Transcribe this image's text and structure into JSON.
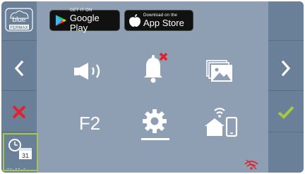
{
  "brand": {
    "logo_text": "blue",
    "logo_subtext": "FERMAX"
  },
  "store_buttons": {
    "google": {
      "small": "GET IT ON",
      "big": "Google Play"
    },
    "apple": {
      "small": "Download on the",
      "big": "App Store"
    }
  },
  "menu": {
    "f2_label": "F2",
    "items": [
      {
        "icon": "volume-icon"
      },
      {
        "icon": "bell-muted-icon"
      },
      {
        "icon": "gallery-icon"
      },
      {
        "icon": "f2-label"
      },
      {
        "icon": "gear-icon",
        "selected": true
      },
      {
        "icon": "smart-home-wifi-icon"
      }
    ]
  },
  "status": {
    "date_placeholder": "--.--.-",
    "calendar_day": "31",
    "indicator_icon": "wifi-off-icon"
  },
  "colors": {
    "background": "#8e9fb3",
    "side_columns": "#6a7f98",
    "accent_red": "#e5202a",
    "accent_green": "#a6c944",
    "icon_white": "#ffffff"
  }
}
